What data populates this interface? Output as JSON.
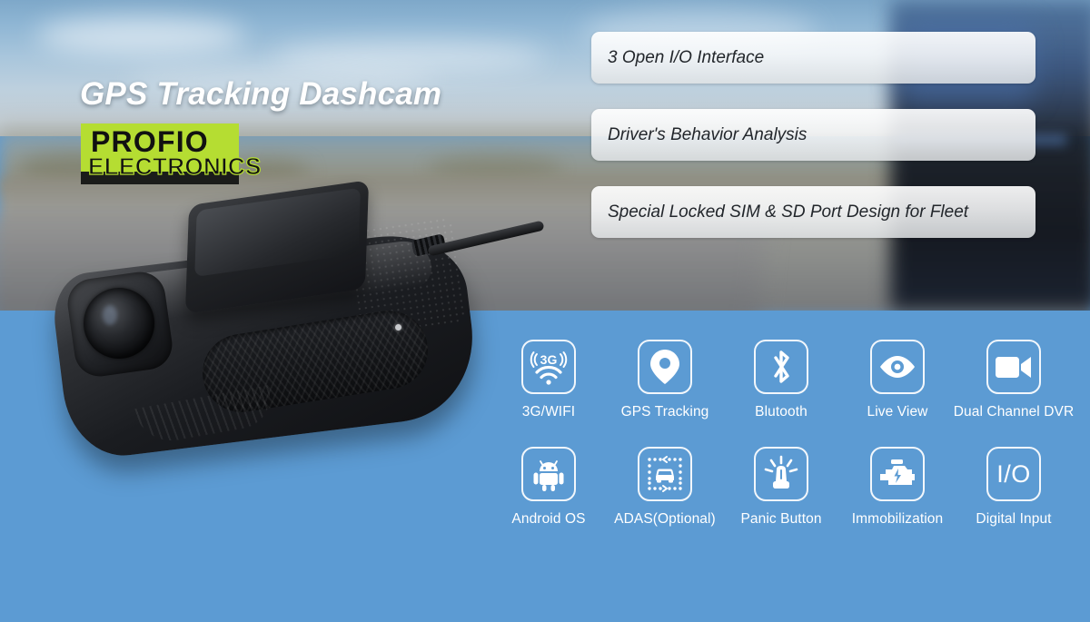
{
  "banner": {
    "headline": "GPS Tracking Dashcam",
    "accent_green": "#b5dd32",
    "panel_blue": "#5c9bd3"
  },
  "logo": {
    "top": "PROFIO",
    "bottom": "ELECTRONICS"
  },
  "features": [
    {
      "label": "3 Open I/O Interface"
    },
    {
      "label": "Driver's Behavior Analysis"
    },
    {
      "label": "Special Locked SIM & SD Port Design for Fleet"
    }
  ],
  "icons": {
    "row1": [
      {
        "label": "3G/WIFI",
        "icon": "3g-wifi-icon"
      },
      {
        "label": "GPS Tracking",
        "icon": "map-pin-icon"
      },
      {
        "label": "Blutooth",
        "icon": "bluetooth-icon"
      },
      {
        "label": "Live View",
        "icon": "eye-icon"
      },
      {
        "label": "Dual Channel DVR",
        "icon": "video-camera-icon"
      }
    ],
    "row2": [
      {
        "label": "Android OS",
        "icon": "android-icon"
      },
      {
        "label": "ADAS(Optional)",
        "icon": "adas-car-icon"
      },
      {
        "label": "Panic Button",
        "icon": "siren-icon"
      },
      {
        "label": "Immobilization",
        "icon": "engine-bolt-icon"
      },
      {
        "label": "Digital Input",
        "icon": "io-icon",
        "text": "I/O"
      }
    ]
  }
}
